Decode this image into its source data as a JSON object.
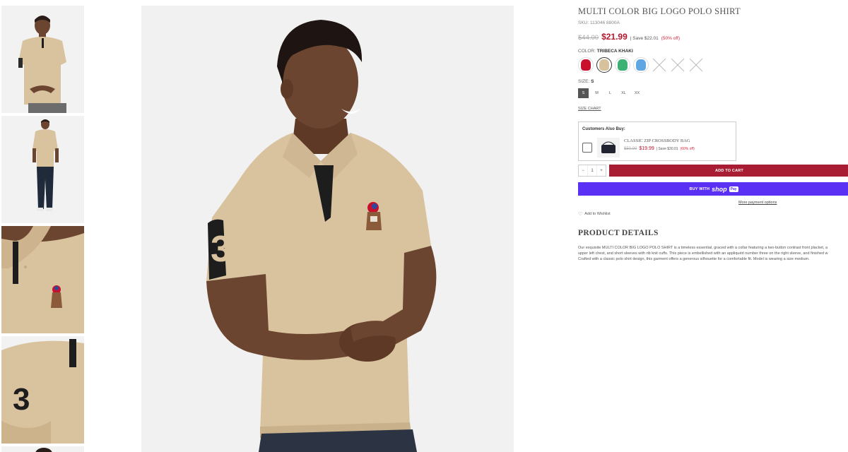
{
  "product": {
    "title": "MULTI COLOR BIG LOGO POLO SHIRT",
    "sku": "SKU: 113046 8800A",
    "old_price": "$44.00",
    "new_price": "$21.99",
    "save_text": "| Save $22.01",
    "save_pct": "(50% off)"
  },
  "color": {
    "label": "COLOR:",
    "value": "TRIBECA KHAKI",
    "swatches": [
      {
        "name": "red",
        "hex": "#c8102e"
      },
      {
        "name": "khaki",
        "hex": "#d8c29d"
      },
      {
        "name": "green",
        "hex": "#3bb273"
      },
      {
        "name": "blue",
        "hex": "#5fa6e3"
      }
    ]
  },
  "size": {
    "label": "SIZE:",
    "value": "S",
    "options": [
      "S",
      "M",
      "L",
      "XL",
      "XX"
    ],
    "chart_link": "SIZE CHART"
  },
  "also_buy": {
    "title": "Customers Also Buy:",
    "item_name": "CLASSIC ZIP CROSSBODY BAG",
    "old_price": "$50.00",
    "new_price": "$19.99",
    "save_text": "| Save $30.01",
    "save_pct": "(60% off)"
  },
  "cart": {
    "minus": "−",
    "qty": "1",
    "plus": "+",
    "add_label": "ADD TO CART",
    "buy_with": "BUY WITH",
    "shop": "shop",
    "pay": "Pay",
    "more_options": "More payment options"
  },
  "wishlist": {
    "label": "Add to Wishlist"
  },
  "details": {
    "heading": "PRODUCT DETAILS",
    "lines": [
      "Our exquisite MULTI COLOR BIG LOGO POLO SHIRT is a timeless essential, graced with a collar featuring a two-button contrast front placket, a",
      "upper left chest, and short sleeves with rib knit cuffs. This piece is embellished with an appliquéd number three on the right sleeve, and finished w",
      "Crafted with a classic polo shirt design, this garment offers a generous silhouette for a comfortable fit. Model is wearing a size medium."
    ]
  },
  "colors": {
    "accent_red": "#b5152b",
    "cart_button": "#a81c34",
    "shop_pay": "#5a31f4",
    "shirt": "#d9c29e"
  }
}
